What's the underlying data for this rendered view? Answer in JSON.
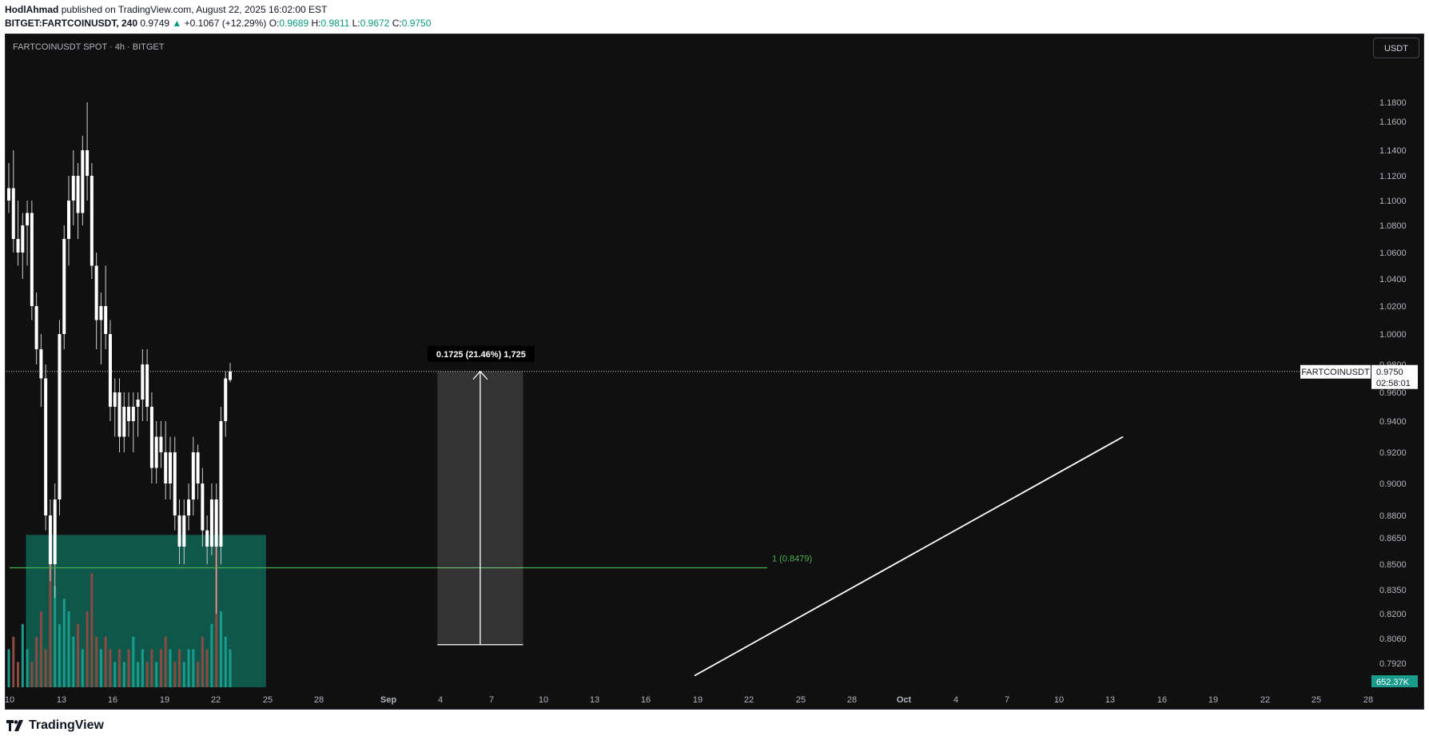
{
  "header": {
    "author": "HodlAhmad",
    "published": "published on TradingView.com, August 22, 2025 16:02:00 EST",
    "symbol": "BITGET:FARTCOINUSDT, 240",
    "last": "0.9749",
    "arrow": "▲",
    "change": "+0.1067 (+12.29%)",
    "o_label": "O:",
    "o_val": "0.9689",
    "h_label": "H:",
    "h_val": "0.9811",
    "l_label": "L:",
    "l_val": "0.9672",
    "c_label": "C:",
    "c_val": "0.9750"
  },
  "chart_title": "FARTCOINUSDT SPOT · 4h · BITGET",
  "currency_button": "USDT",
  "footer": {
    "brand": "TradingView"
  },
  "colors": {
    "background": "#101010",
    "candle": "#ffffff",
    "zone": "#0f5f52",
    "fib": "#4caf50",
    "volume_up": "#1a9c8c",
    "volume_down": "#8c4a40",
    "price_tag_bg": "#ffffff",
    "volume_tag_bg": "#1a9c8c"
  },
  "chart_data": {
    "type": "candlestick",
    "symbol": "FARTCOINUSDT",
    "timeframe": "4h",
    "y_ticks": [
      "1.1800",
      "1.1600",
      "1.1400",
      "1.1200",
      "1.1000",
      "1.0800",
      "1.0600",
      "1.0400",
      "1.0200",
      "1.0000",
      "0.9800",
      "0.9600",
      "0.9400",
      "0.9200",
      "0.9000",
      "0.8800",
      "0.8650",
      "0.8500",
      "0.8350",
      "0.8200",
      "0.8060",
      "0.7920"
    ],
    "x_ticks": [
      "10",
      "13",
      "16",
      "19",
      "22",
      "25",
      "28",
      "Sep",
      "4",
      "7",
      "10",
      "13",
      "16",
      "19",
      "22",
      "25",
      "28",
      "Oct",
      "4",
      "7",
      "10",
      "13",
      "16",
      "19",
      "22",
      "25",
      "28"
    ],
    "candles": [
      [
        1.1,
        1.13,
        1.09,
        1.11
      ],
      [
        1.11,
        1.14,
        1.06,
        1.07
      ],
      [
        1.07,
        1.1,
        1.05,
        1.06
      ],
      [
        1.06,
        1.09,
        1.04,
        1.08
      ],
      [
        1.08,
        1.1,
        1.05,
        1.09
      ],
      [
        1.09,
        1.1,
        1.01,
        1.02
      ],
      [
        1.02,
        1.03,
        0.98,
        0.99
      ],
      [
        0.99,
        1.0,
        0.95,
        0.97
      ],
      [
        0.97,
        0.98,
        0.87,
        0.88
      ],
      [
        0.88,
        0.89,
        0.84,
        0.85
      ],
      [
        0.85,
        0.9,
        0.83,
        0.89
      ],
      [
        0.89,
        1.01,
        0.88,
        1.0
      ],
      [
        1.0,
        1.08,
        0.99,
        1.07
      ],
      [
        1.07,
        1.12,
        1.05,
        1.1
      ],
      [
        1.1,
        1.14,
        1.08,
        1.12
      ],
      [
        1.12,
        1.13,
        1.07,
        1.09
      ],
      [
        1.09,
        1.15,
        1.08,
        1.14
      ],
      [
        1.14,
        1.18,
        1.1,
        1.12
      ],
      [
        1.12,
        1.13,
        1.04,
        1.05
      ],
      [
        1.05,
        1.06,
        0.99,
        1.01
      ],
      [
        1.01,
        1.03,
        0.98,
        1.02
      ],
      [
        1.02,
        1.05,
        0.99,
        1.0
      ],
      [
        1.0,
        1.01,
        0.94,
        0.95
      ],
      [
        0.95,
        0.97,
        0.93,
        0.96
      ],
      [
        0.96,
        0.97,
        0.92,
        0.93
      ],
      [
        0.93,
        0.96,
        0.92,
        0.95
      ],
      [
        0.95,
        0.96,
        0.93,
        0.94
      ],
      [
        0.94,
        0.96,
        0.92,
        0.95
      ],
      [
        0.95,
        0.96,
        0.93,
        0.955
      ],
      [
        0.955,
        0.99,
        0.94,
        0.98
      ],
      [
        0.98,
        0.99,
        0.94,
        0.95
      ],
      [
        0.95,
        0.96,
        0.9,
        0.91
      ],
      [
        0.91,
        0.94,
        0.9,
        0.93
      ],
      [
        0.93,
        0.94,
        0.91,
        0.92
      ],
      [
        0.92,
        0.94,
        0.89,
        0.9
      ],
      [
        0.9,
        0.93,
        0.89,
        0.92
      ],
      [
        0.92,
        0.93,
        0.87,
        0.88
      ],
      [
        0.88,
        0.89,
        0.85,
        0.86
      ],
      [
        0.86,
        0.89,
        0.85,
        0.88
      ],
      [
        0.88,
        0.9,
        0.87,
        0.89
      ],
      [
        0.89,
        0.93,
        0.88,
        0.92
      ],
      [
        0.92,
        0.925,
        0.89,
        0.9
      ],
      [
        0.9,
        0.91,
        0.86,
        0.87
      ],
      [
        0.87,
        0.88,
        0.85,
        0.86
      ],
      [
        0.86,
        0.9,
        0.855,
        0.89
      ],
      [
        0.89,
        0.9,
        0.82,
        0.86
      ],
      [
        0.86,
        0.95,
        0.85,
        0.94
      ],
      [
        0.94,
        0.975,
        0.93,
        0.97
      ],
      [
        0.9689,
        0.9811,
        0.9672,
        0.975
      ]
    ],
    "volume": {
      "label": "652.37K",
      "values": [
        3,
        4,
        2,
        5,
        3,
        2,
        4,
        6,
        3,
        10,
        8,
        5,
        7,
        6,
        4,
        5,
        3,
        6,
        9,
        4,
        3,
        4,
        3,
        2,
        3,
        2,
        3,
        4,
        2,
        3,
        2,
        3,
        2,
        3,
        4,
        3,
        2,
        3,
        2,
        3,
        3,
        2,
        4,
        3,
        5,
        12,
        6,
        4,
        3
      ]
    },
    "current": {
      "label": "FARTCOINUSDT",
      "price": "0.9750",
      "countdown": "02:58:01",
      "value": 0.975
    },
    "zone": {
      "from_date": "Aug 11",
      "to_date": "Aug 25",
      "top": 0.867,
      "bottom": 0.79
    },
    "fib_level": {
      "label": "1 (0.8479)",
      "value": 0.8479
    },
    "measure": {
      "label": "0.1725 (21.46%) 1,725",
      "from": 0.8025,
      "to": 0.975,
      "from_date": "Sep 4",
      "to_date": "Sep 9"
    },
    "trend_line": {
      "from": {
        "date": "Sep 19",
        "value": 0.785
      },
      "to": {
        "date": "Oct 14",
        "value": 0.93
      }
    }
  }
}
